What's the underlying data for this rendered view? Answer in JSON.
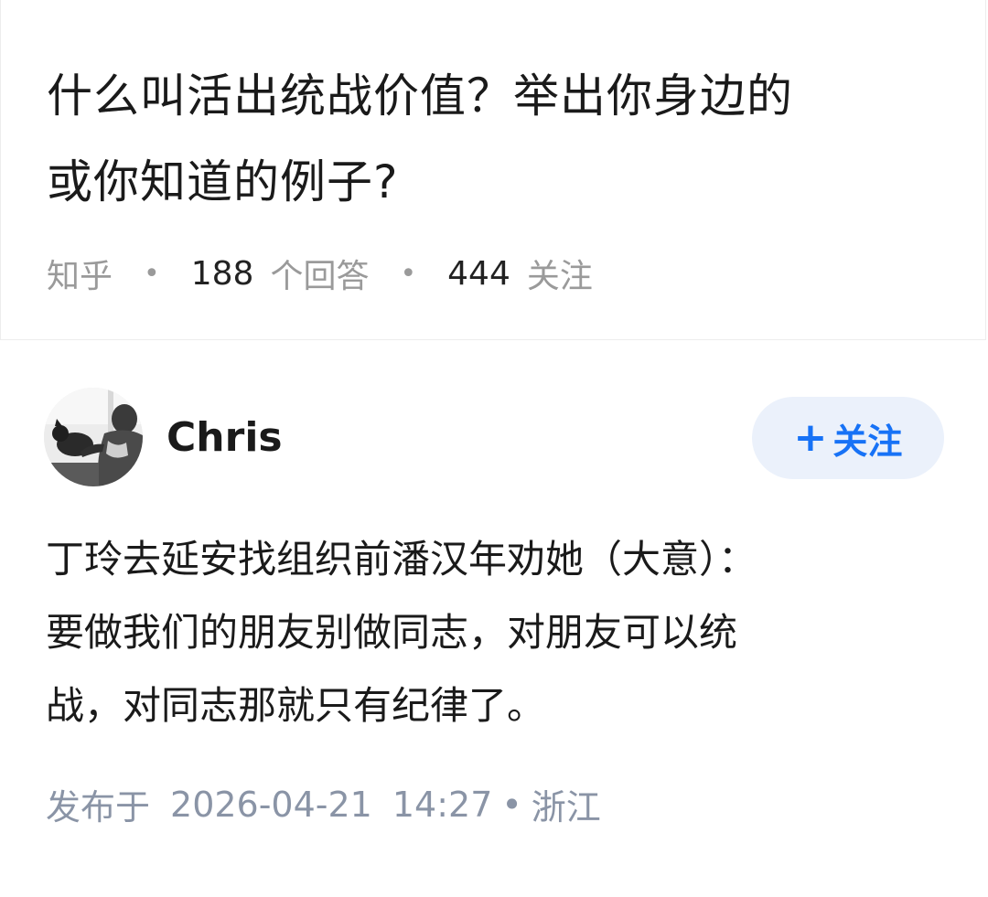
{
  "question": {
    "title_line1": "什么叫活出统战价值？举出你身边的",
    "title_line2": "或你知道的例子?",
    "source": "知乎",
    "answers_count": "188",
    "answers_label": "个回答",
    "follow_count": "444",
    "follow_label": "关注"
  },
  "answer": {
    "author": "Chris",
    "follow_button_plus": "+",
    "follow_button_label": "关注",
    "content_lines": [
      "丁玲去延安找组织前潘汉年劝她（大意）：",
      "要做我们的朋友别做同志，对朋友可以统",
      "战，对同志那就只有纪律了。"
    ],
    "published_label": "发布于",
    "date": "2026-04-21",
    "time": "14:27",
    "separator": "•",
    "location": "浙江"
  },
  "colors": {
    "accent": "#1772f6",
    "follow_bg": "#ebf1fb",
    "meta_gray": "#9a9a9a",
    "footer_gray": "#8a94a6"
  }
}
